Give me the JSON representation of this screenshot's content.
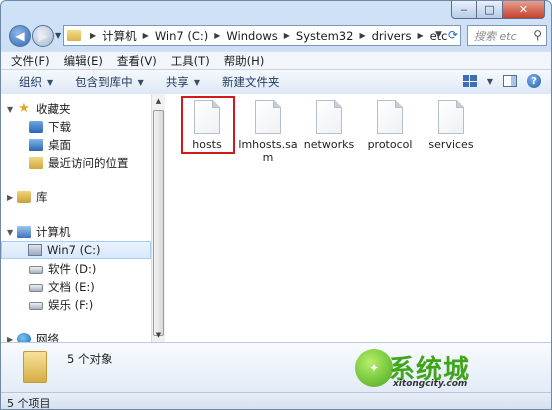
{
  "window_controls": {
    "minimize": "‒",
    "maximize": "□",
    "close": "✕"
  },
  "nav": {
    "back_glyph": "◀",
    "forward_glyph": "▶",
    "breadcrumb": [
      "计算机",
      "Win7 (C:)",
      "Windows",
      "System32",
      "drivers",
      "etc"
    ],
    "search_placeholder": "搜索 etc"
  },
  "menu": [
    "文件(F)",
    "编辑(E)",
    "查看(V)",
    "工具(T)",
    "帮助(H)"
  ],
  "toolbar": {
    "organize": "组织",
    "include_library": "包含到库中",
    "share": "共享",
    "new_folder": "新建文件夹"
  },
  "sidebar": {
    "favorites": "收藏夹",
    "downloads": "下载",
    "desktop": "桌面",
    "recent": "最近访问的位置",
    "libraries": "库",
    "computer": "计算机",
    "drive_c": "Win7 (C:)",
    "drive_d": "软件 (D:)",
    "drive_e": "文档 (E:)",
    "drive_f": "娱乐 (F:)",
    "network": "网络"
  },
  "files": [
    {
      "name": "hosts",
      "icon": "document-icon"
    },
    {
      "name": "lmhosts.sam",
      "icon": "document-icon"
    },
    {
      "name": "networks",
      "icon": "document-icon"
    },
    {
      "name": "protocol",
      "icon": "document-icon"
    },
    {
      "name": "services",
      "icon": "document-icon"
    }
  ],
  "details": {
    "count": "5 个对象"
  },
  "watermark": {
    "brand": "系统城",
    "site": "xitongcity.com"
  },
  "status": {
    "text": "5 个项目"
  },
  "colors": {
    "highlight": "#d21a1a",
    "window_frame": "#b9d2ee",
    "watermark_green": "#3fa51a"
  }
}
